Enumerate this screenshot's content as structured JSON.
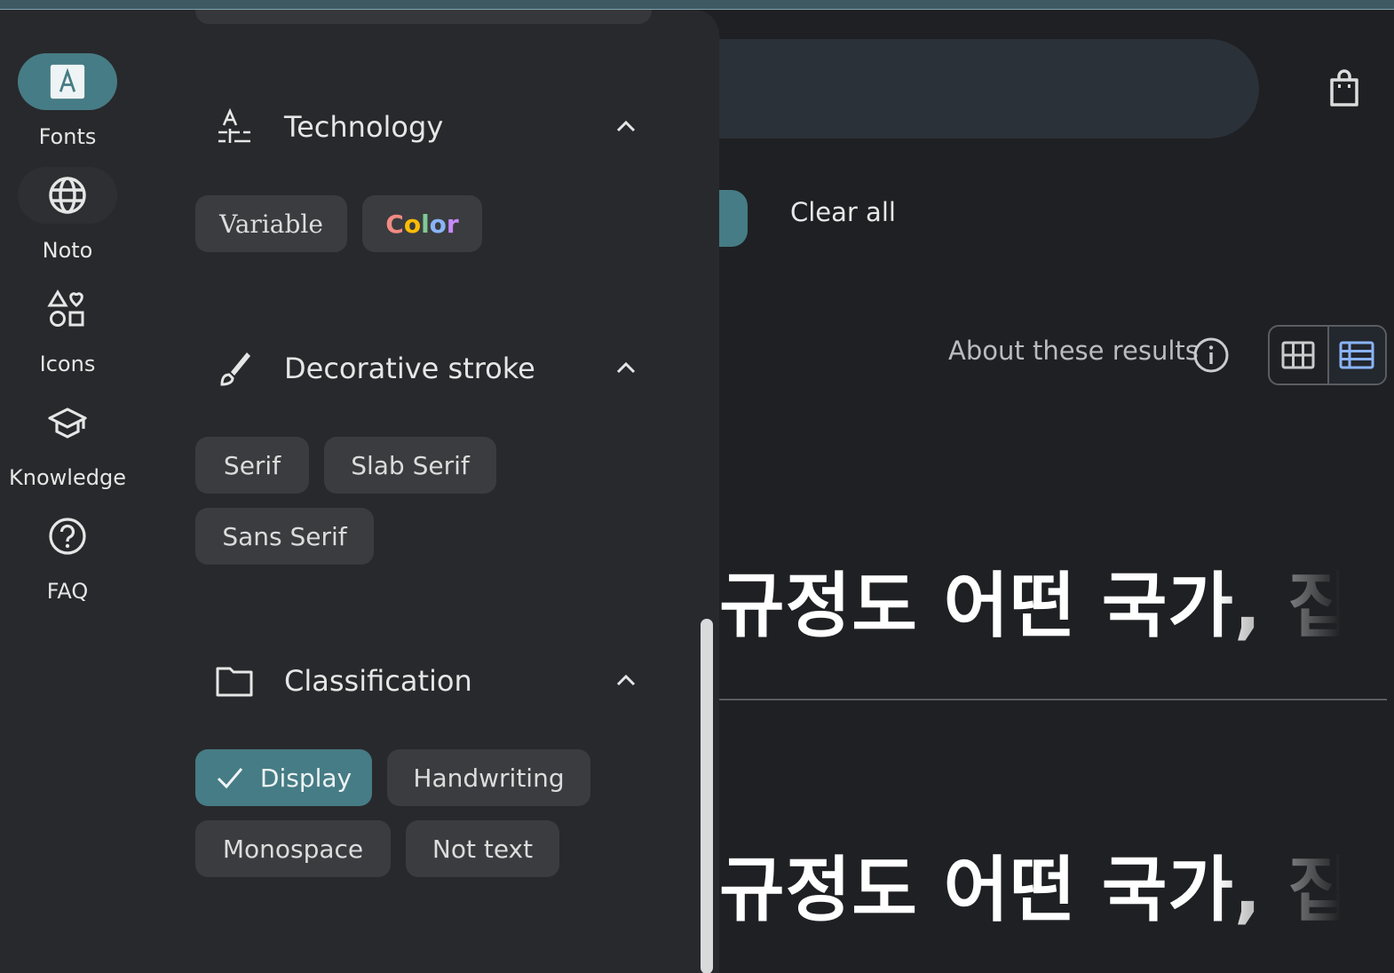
{
  "rail": {
    "items": [
      {
        "label": "Fonts",
        "icon": "font-a-icon",
        "active": true
      },
      {
        "label": "Noto",
        "icon": "globe-icon"
      },
      {
        "label": "Icons",
        "icon": "shapes-icon"
      },
      {
        "label": "Knowledge",
        "icon": "graduation-cap-icon"
      },
      {
        "label": "FAQ",
        "icon": "help-circle-icon"
      }
    ]
  },
  "filters": {
    "technology": {
      "title": "Technology",
      "chips": [
        "Variable",
        "Color"
      ]
    },
    "decorative_stroke": {
      "title": "Decorative stroke",
      "chips": [
        "Serif",
        "Slab Serif",
        "Sans Serif"
      ]
    },
    "classification": {
      "title": "Classification",
      "chips": [
        "Display",
        "Handwriting",
        "Monospace",
        "Not text"
      ],
      "selected": "Display"
    }
  },
  "toolbar": {
    "clear_all": "Clear all",
    "about_results": "About these results"
  },
  "samples": {
    "row1": "규정도 어떤 국가, 집단 또",
    "row2": "규정도 어떤 국가, 집단 또"
  },
  "colors": {
    "accent": "#467c85",
    "panel": "#28292c",
    "background": "#1f2023",
    "list_view_active": "#8ab4f8"
  }
}
